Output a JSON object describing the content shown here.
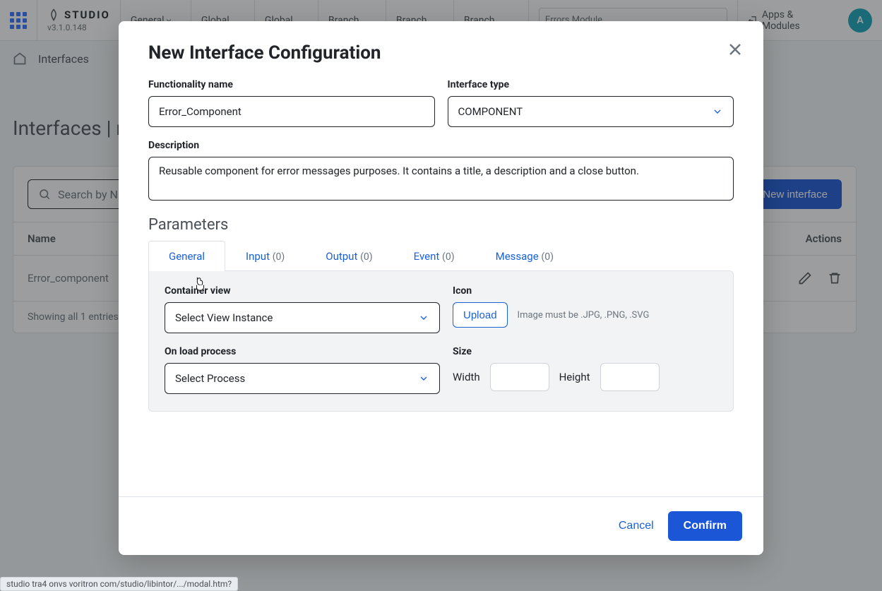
{
  "topbar": {
    "studio": "STUDIO",
    "version": "v3.1.0.148",
    "dropdowns": [
      "General",
      "Global",
      "Global",
      "Branch",
      "Branch",
      "Branch"
    ],
    "search_value": "Errors Module",
    "apps_modules": "Apps & Modules",
    "avatar": "A"
  },
  "breadcrumb": {
    "item": "Interfaces"
  },
  "page_title": "Interfaces | n",
  "panel": {
    "search_placeholder": "Search by N",
    "new_button": "New interface",
    "columns": {
      "name": "Name",
      "actions": "Actions"
    },
    "rows": [
      {
        "name": "Error_component"
      }
    ],
    "footer": "Showing all 1 entries"
  },
  "modal": {
    "title": "New Interface Configuration",
    "fn_label": "Functionality name",
    "fn_value": "Error_Component",
    "type_label": "Interface type",
    "type_value": "COMPONENT",
    "desc_label": "Description",
    "desc_value": "Reusable component for error messages purposes. It contains a title, a description and a close button.",
    "params_label": "Parameters",
    "tabs": {
      "general": "General",
      "input": "Input",
      "input_cnt": "(0)",
      "output": "Output",
      "output_cnt": "(0)",
      "event": "Event",
      "event_cnt": "(0)",
      "message": "Message",
      "message_cnt": "(0)"
    },
    "cv_label": "Container view",
    "cv_value": "Select View Instance",
    "olp_label": "On load process",
    "olp_value": "Select Process",
    "icon_label": "Icon",
    "upload": "Upload",
    "upload_hint": "Image must be .JPG, .PNG, .SVG",
    "size_label": "Size",
    "width_label": "Width",
    "height_label": "Height",
    "cancel": "Cancel",
    "confirm": "Confirm"
  },
  "status_url": "studio tra4 onvs voritron com/studio/libintor/.../modal.htm?"
}
